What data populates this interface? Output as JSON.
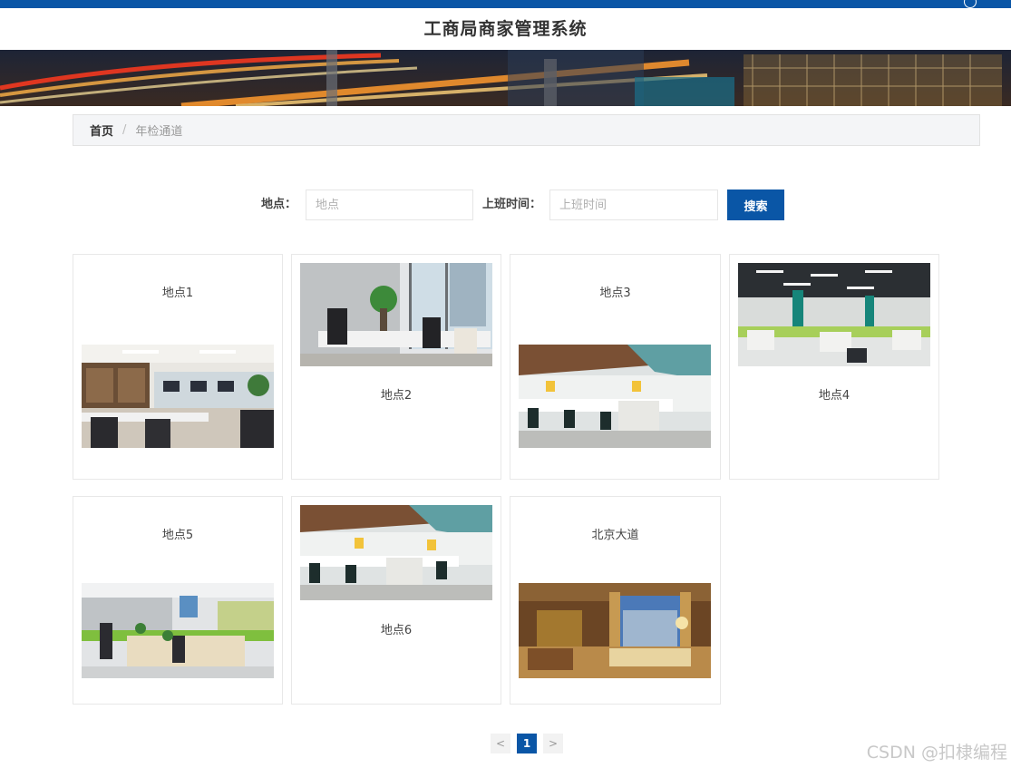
{
  "header": {
    "title": "工商局商家管理系统"
  },
  "breadcrumb": {
    "home": "首页",
    "separator": "/",
    "current": "年检通道"
  },
  "search": {
    "location_label": "地点：",
    "location_placeholder": "地点",
    "location_value": "",
    "time_label": "上班时间：",
    "time_placeholder": "上班时间",
    "time_value": "",
    "button_label": "搜索"
  },
  "cards": [
    {
      "title": "地点1"
    },
    {
      "title": "地点2"
    },
    {
      "title": "地点3"
    },
    {
      "title": "地点4"
    },
    {
      "title": "地点5"
    },
    {
      "title": "地点6"
    },
    {
      "title": "北京大道"
    }
  ],
  "pagination": {
    "prev": "<",
    "current": "1",
    "next": ">"
  },
  "watermark": "CSDN @扣棣编程",
  "colors": {
    "accent": "#0a56a6",
    "breadcrumb_bg": "#f4f5f7"
  },
  "icons": {
    "user": "user-circle-icon"
  }
}
